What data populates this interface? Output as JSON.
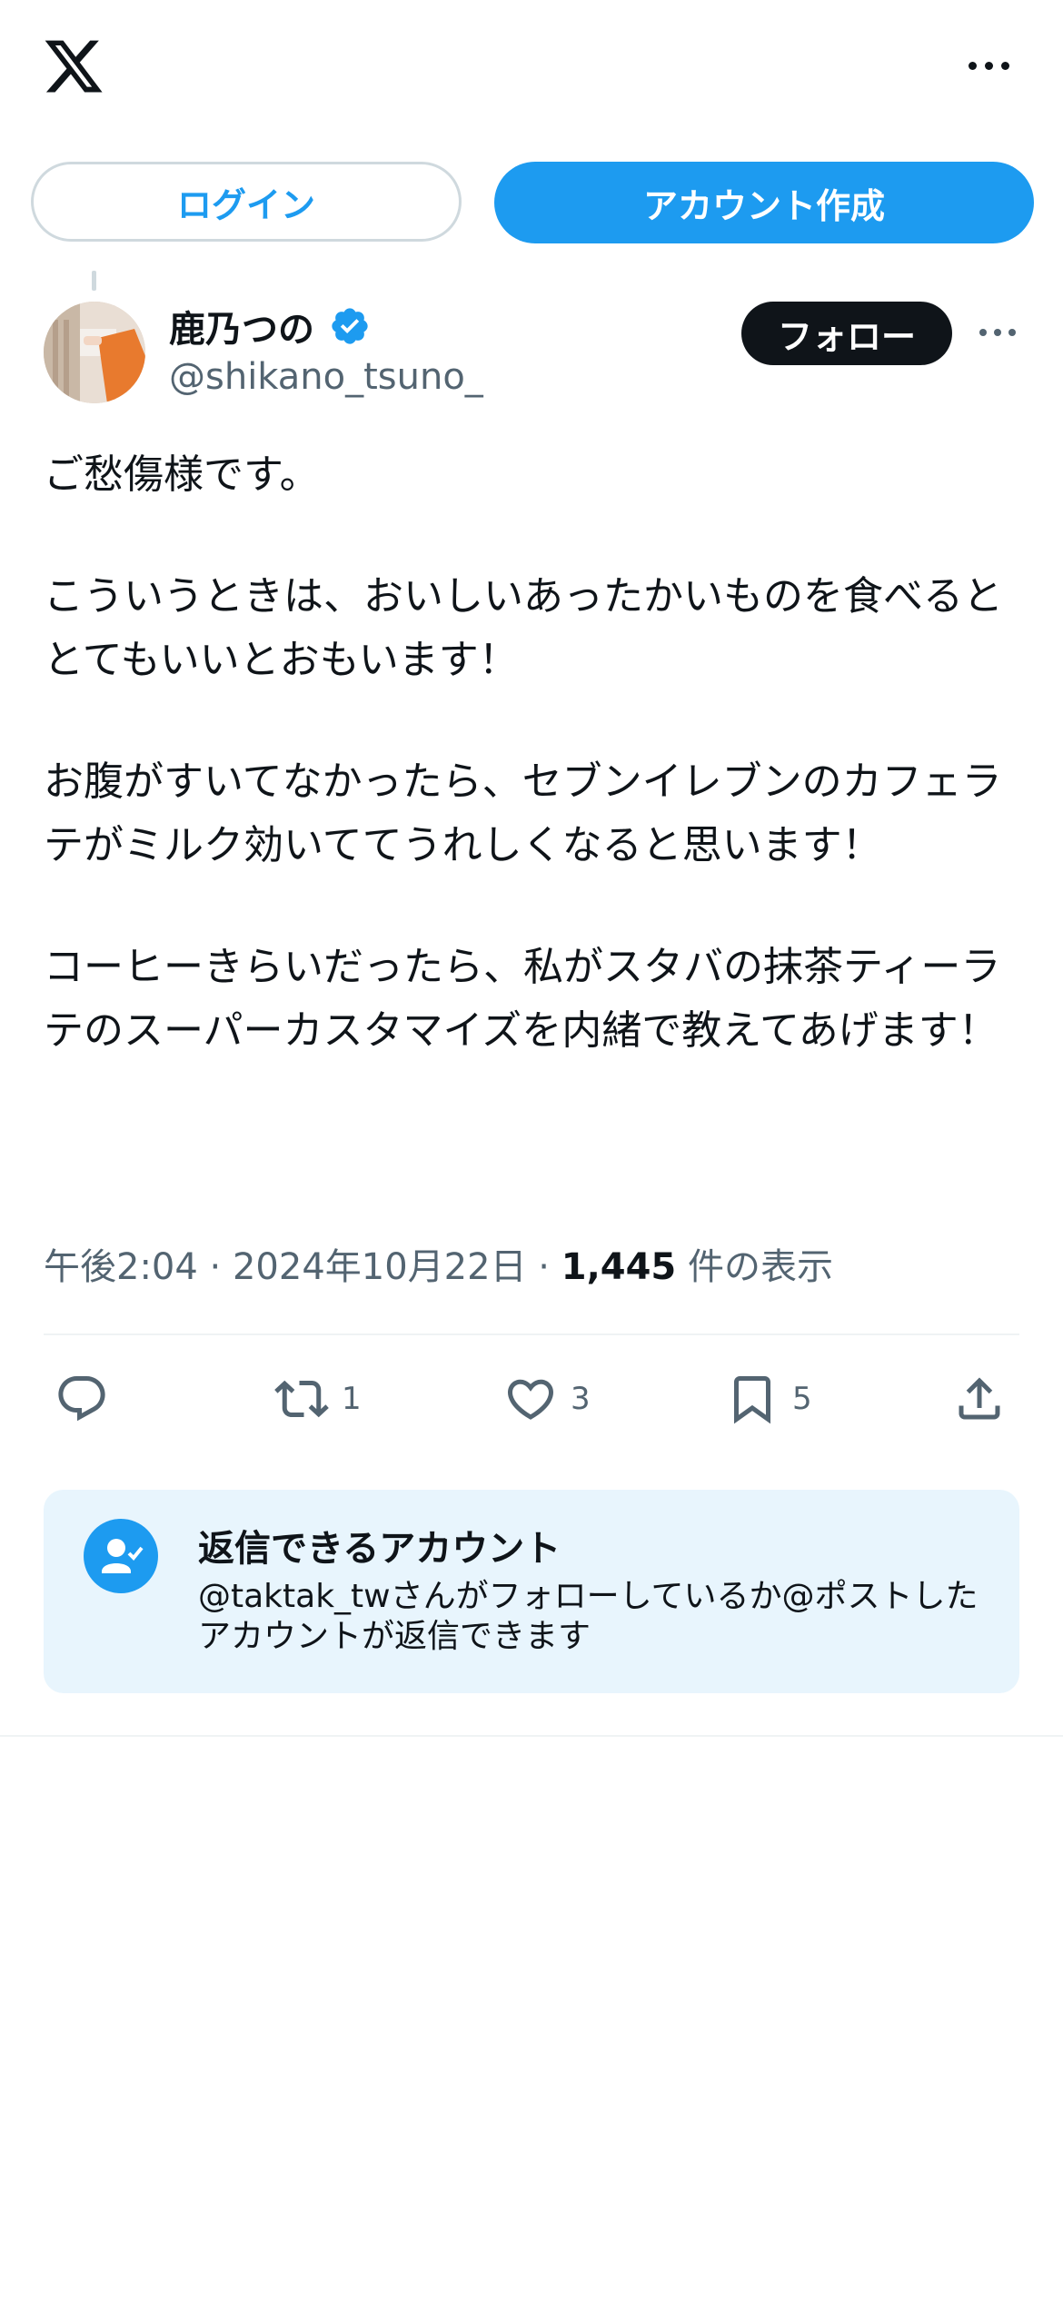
{
  "header": {
    "logo_icon": "x-logo-icon",
    "more_icon": "more-horizontal-icon"
  },
  "auth": {
    "login_label": "ログイン",
    "signup_label": "アカウント作成"
  },
  "tweet": {
    "author_name": "鹿乃つの",
    "author_handle": "@shikano_tsuno_",
    "verified": true,
    "follow_label": "フォロー",
    "paragraphs": [
      "ご愁傷様です。",
      "こういうときは、おいしいあったかいものを食べるととてもいいとおもいます！",
      "お腹がすいてなかったら、セブンイレブンのカフェラテがミルク効いててうれしくなると思います！",
      "コーヒーきらいだったら、私がスタバの抹茶ティーラテのスーパーカスタマイズを内緒で教えてあげます！"
    ],
    "time": "午後2:04",
    "date": "2024年10月22日",
    "view_count": "1,445",
    "view_suffix": "件の表示",
    "separator": "·",
    "actions": {
      "reply_count": "",
      "retweet_count": "1",
      "like_count": "3",
      "bookmark_count": "5"
    }
  },
  "reply_restriction": {
    "title": "返信できるアカウント",
    "description": "@taktak_twさんがフォローしているか@ポストしたアカウントが返信できます"
  },
  "colors": {
    "accent": "#1d9bf0",
    "text_primary": "#0f1419",
    "text_secondary": "#536471",
    "card_bg": "#e8f5fd",
    "border": "#cfd9de"
  }
}
